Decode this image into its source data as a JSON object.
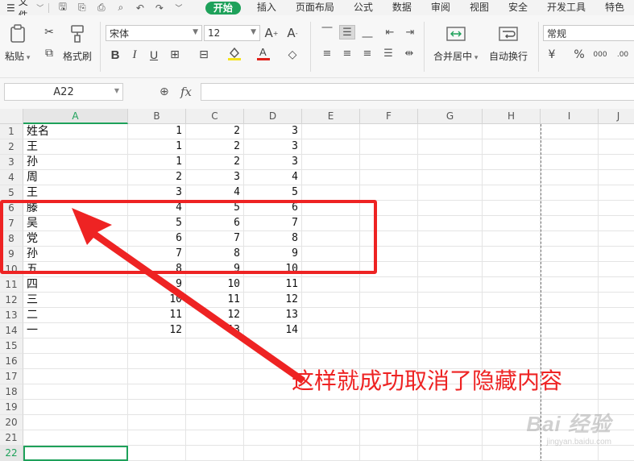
{
  "menubar": {
    "file_label": "文件",
    "tabs": [
      {
        "label": "开始",
        "active": true
      },
      {
        "label": "插入"
      },
      {
        "label": "页面布局"
      },
      {
        "label": "公式"
      },
      {
        "label": "数据"
      },
      {
        "label": "审阅"
      },
      {
        "label": "视图"
      },
      {
        "label": "安全"
      },
      {
        "label": "开发工具"
      },
      {
        "label": "特色"
      }
    ]
  },
  "ribbon": {
    "paste_label": "粘贴",
    "format_painter_label": "格式刷",
    "font_name": "宋体",
    "font_size": "12",
    "merge_label": "合并居中",
    "wrap_label": "自动换行",
    "number_format": "常规",
    "accent_color": "#1ea15a",
    "font_color_bar": "#e0201a",
    "fill_color_bar": "#f5e21b"
  },
  "formulabar": {
    "cell_ref": "A22",
    "fx_label": "fx",
    "formula": ""
  },
  "grid": {
    "columns": [
      "A",
      "B",
      "C",
      "D",
      "E",
      "F",
      "G",
      "H",
      "I",
      "J"
    ],
    "row_numbers": [
      "1",
      "2",
      "3",
      "4",
      "5",
      "6",
      "7",
      "8",
      "9",
      "10",
      "11",
      "12",
      "13",
      "14",
      "15",
      "16",
      "17",
      "18",
      "19",
      "20",
      "21",
      "22"
    ],
    "rows": [
      [
        "姓名",
        "1",
        "2",
        "3"
      ],
      [
        "王",
        "1",
        "2",
        "3"
      ],
      [
        "孙",
        "1",
        "2",
        "3"
      ],
      [
        "周",
        "2",
        "3",
        "4"
      ],
      [
        "王",
        "3",
        "4",
        "5"
      ],
      [
        "滕",
        "4",
        "5",
        "6"
      ],
      [
        "吴",
        "5",
        "6",
        "7"
      ],
      [
        "党",
        "6",
        "7",
        "8"
      ],
      [
        "孙",
        "7",
        "8",
        "9"
      ],
      [
        "五",
        "8",
        "9",
        "10"
      ],
      [
        "四",
        "9",
        "10",
        "11"
      ],
      [
        "三",
        "10",
        "11",
        "12"
      ],
      [
        "二",
        "11",
        "12",
        "13"
      ],
      [
        "一",
        "12",
        "13",
        "14"
      ]
    ],
    "active_cell": "A22"
  },
  "annotation": {
    "text": "这样就成功取消了隐藏内容",
    "color": "#ee2323"
  },
  "watermark": {
    "line1": "Bai 经验",
    "line2": "jingyan.baidu.com"
  }
}
